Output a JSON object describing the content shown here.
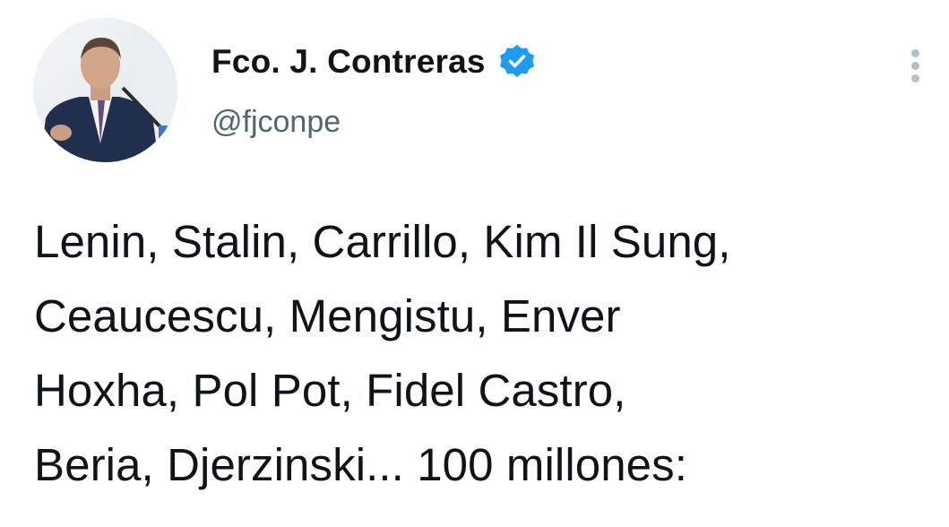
{
  "author": {
    "display_name": "Fco. J. Contreras",
    "handle": "@fjconpe",
    "verified": true
  },
  "icons": {
    "verified": "verified-badge-icon",
    "more": "more-options-icon"
  },
  "colors": {
    "verified_badge": "#1d9bf0",
    "text": "#0f1419",
    "secondary_text": "#536471"
  },
  "tweet": {
    "lines": [
      "Lenin, Stalin, Carrillo, Kim Il Sung,",
      "Ceaucescu, Mengistu, Enver",
      "Hoxha, Pol Pot, Fidel Castro,",
      "Beria, Djerzinski... 100 millones:"
    ]
  }
}
